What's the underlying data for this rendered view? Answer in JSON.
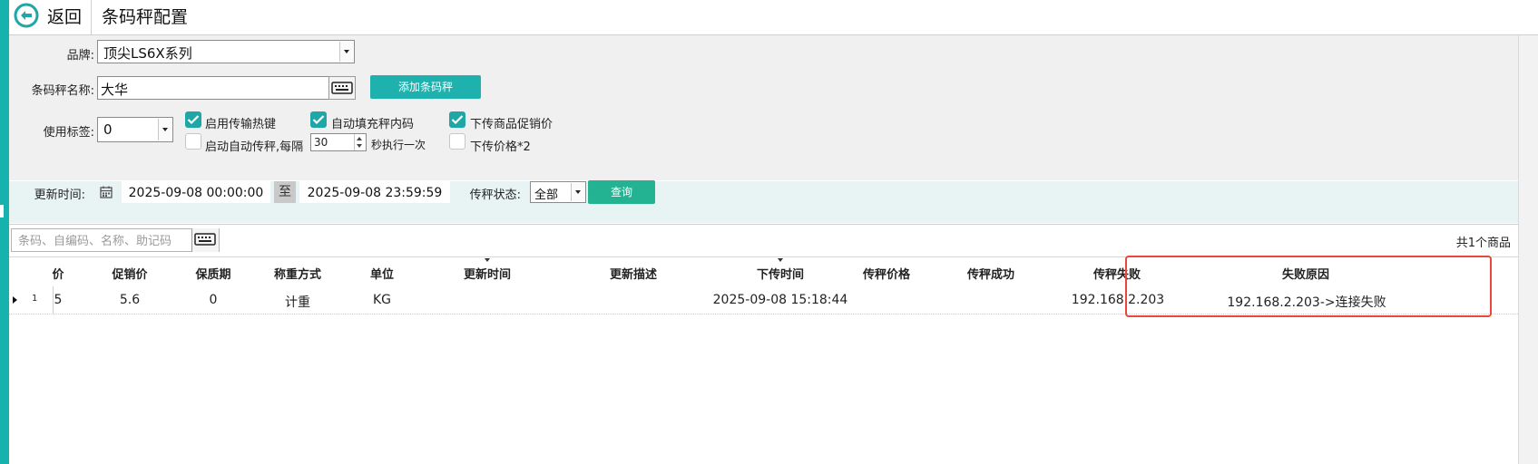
{
  "header": {
    "back_label": "返回",
    "title": "条码秤配置"
  },
  "config": {
    "brand_label": "品牌:",
    "brand_value": "顶尖LS6X系列",
    "scale_name_label": "条码秤名称:",
    "scale_name_value": "大华",
    "add_button": "添加条码秤",
    "use_label_label": "使用标签:",
    "use_label_value": "0",
    "checkboxes": {
      "hotkey": {
        "label": "启用传输热键",
        "checked": true
      },
      "autofill": {
        "label": "自动填充秤内码",
        "checked": true
      },
      "promo": {
        "label": "下传商品促销价",
        "checked": true
      },
      "auto_transfer": {
        "label": "启动自动传秤,每隔",
        "checked": false
      },
      "price_double": {
        "label": "下传价格*2",
        "checked": false
      }
    },
    "interval_value": "30",
    "interval_suffix": "秒执行一次"
  },
  "filter": {
    "update_time_label": "更新时间:",
    "date_from": "2025-09-08 00:00:00",
    "to_label": "至",
    "date_to": "2025-09-08 23:59:59",
    "status_label": "传秤状态:",
    "status_value": "全部",
    "query_button": "查询"
  },
  "search": {
    "placeholder": "条码、自编码、名称、助记码",
    "count_text": "共1个商品"
  },
  "table": {
    "columns": [
      "价",
      "促销价",
      "保质期",
      "称重方式",
      "单位",
      "更新时间",
      "更新描述",
      "下传时间",
      "传秤价格",
      "传秤成功",
      "传秤失败",
      "失败原因"
    ],
    "rows": [
      {
        "num": "1",
        "cells": [
          "5",
          "5.6",
          "0",
          "计重",
          "KG",
          "",
          "",
          "2025-09-08 15:18:44",
          "",
          "",
          "192.168.2.203",
          "192.168.2.203->连接失败"
        ]
      }
    ]
  },
  "colors": {
    "accent": "#1fb1ad",
    "highlight": "#e8473c",
    "query_button": "#23b393"
  }
}
